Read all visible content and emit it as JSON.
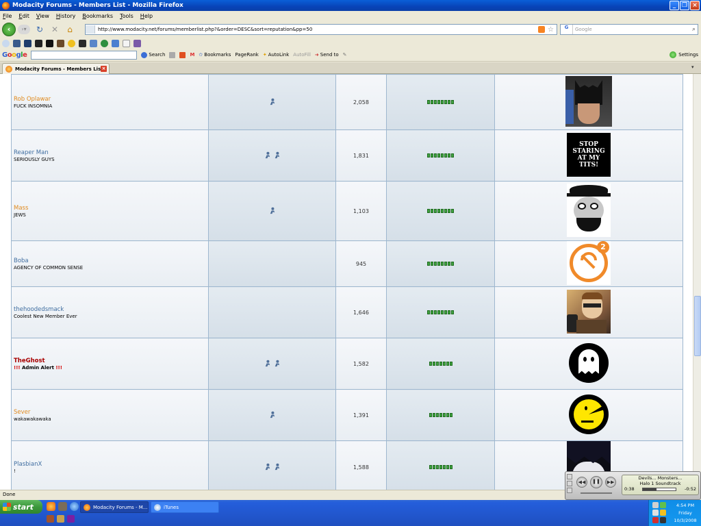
{
  "window": {
    "title": "Modacity Forums - Members List - Mozilla Firefox",
    "buttons": [
      "_",
      "❐",
      "×"
    ]
  },
  "menu": [
    "File",
    "Edit",
    "View",
    "History",
    "Bookmarks",
    "Tools",
    "Help"
  ],
  "nav": {
    "url": "http://www.modacity.net/forums/memberlist.php?&order=DESC&sort=reputation&pp=50",
    "search_placeholder": "Google"
  },
  "google_toolbar": {
    "logo": "Google",
    "search_label": "Search",
    "bookmarks_label": "Bookmarks",
    "pagerank_label": "PageRank",
    "autolink_label": "AutoLink",
    "autofill_label": "AutoFill",
    "sendto_label": "Send to",
    "settings_label": "Settings"
  },
  "tab": {
    "label": "Modacity Forums - Members List"
  },
  "members": [
    {
      "name": "Rob Oplawar",
      "title": "FUCK INSOMNIA",
      "posts": "2,058",
      "rep": 8,
      "im_icons": 1,
      "name_color": "gold",
      "avatar": "batman"
    },
    {
      "name": "Reaper Man",
      "title": "SERIOUSLY GUYS",
      "posts": "1,831",
      "rep": 8,
      "im_icons": 2,
      "name_color": "blue",
      "avatar": "stop-staring-text",
      "avatar_text": "STOP STARING AT MY TITS!"
    },
    {
      "name": "Mass",
      "title": "JEWS",
      "posts": "1,103",
      "rep": 8,
      "im_icons": 1,
      "name_color": "gold",
      "avatar": "cartoon-face"
    },
    {
      "name": "Boba",
      "title": "AGENCY OF COMMON SENSE",
      "posts": "945",
      "rep": 8,
      "im_icons": 0,
      "name_color": "blue",
      "avatar": "hammer-sickle-logo",
      "avatar_text": "2"
    },
    {
      "name": "thehoodedsmack",
      "title": "Coolest New Member Ever",
      "posts": "1,646",
      "rep": 8,
      "im_icons": 0,
      "name_color": "blue",
      "avatar": "photo-phone"
    },
    {
      "name": "TheGhost",
      "title": "Admin Alert",
      "title_bangs": "!!!",
      "posts": "1,582",
      "rep": 7,
      "im_icons": 2,
      "name_color": "admin",
      "avatar": "ghost"
    },
    {
      "name": "Sever",
      "title": "wakawakawaka",
      "posts": "1,391",
      "rep": 7,
      "im_icons": 1,
      "name_color": "gold",
      "avatar": "pacman"
    },
    {
      "name": "PlasbianX",
      "title": "!",
      "posts": "1,588",
      "rep": 7,
      "im_icons": 2,
      "name_color": "blue",
      "avatar": "anime-face"
    }
  ],
  "status": {
    "text": "Done"
  },
  "itunes": {
    "track": "Devils... Monsters...",
    "album": "Halo 1 Soundtrack",
    "elapsed": "0:38",
    "remaining": "-0:52",
    "progress": 0.42
  },
  "taskbar": {
    "start_label": "start",
    "tasks": [
      "Modacity Forums - M...",
      "iTunes"
    ],
    "clock_time": "4:54 PM",
    "clock_day": "Friday",
    "clock_date": "10/3/2008"
  },
  "colors": {
    "name_gold": "#e08a1e",
    "name_blue": "#3f6da0",
    "name_admin": "#a80000",
    "rep_green": "#3fa43f",
    "table_border": "#9eb7cf"
  }
}
